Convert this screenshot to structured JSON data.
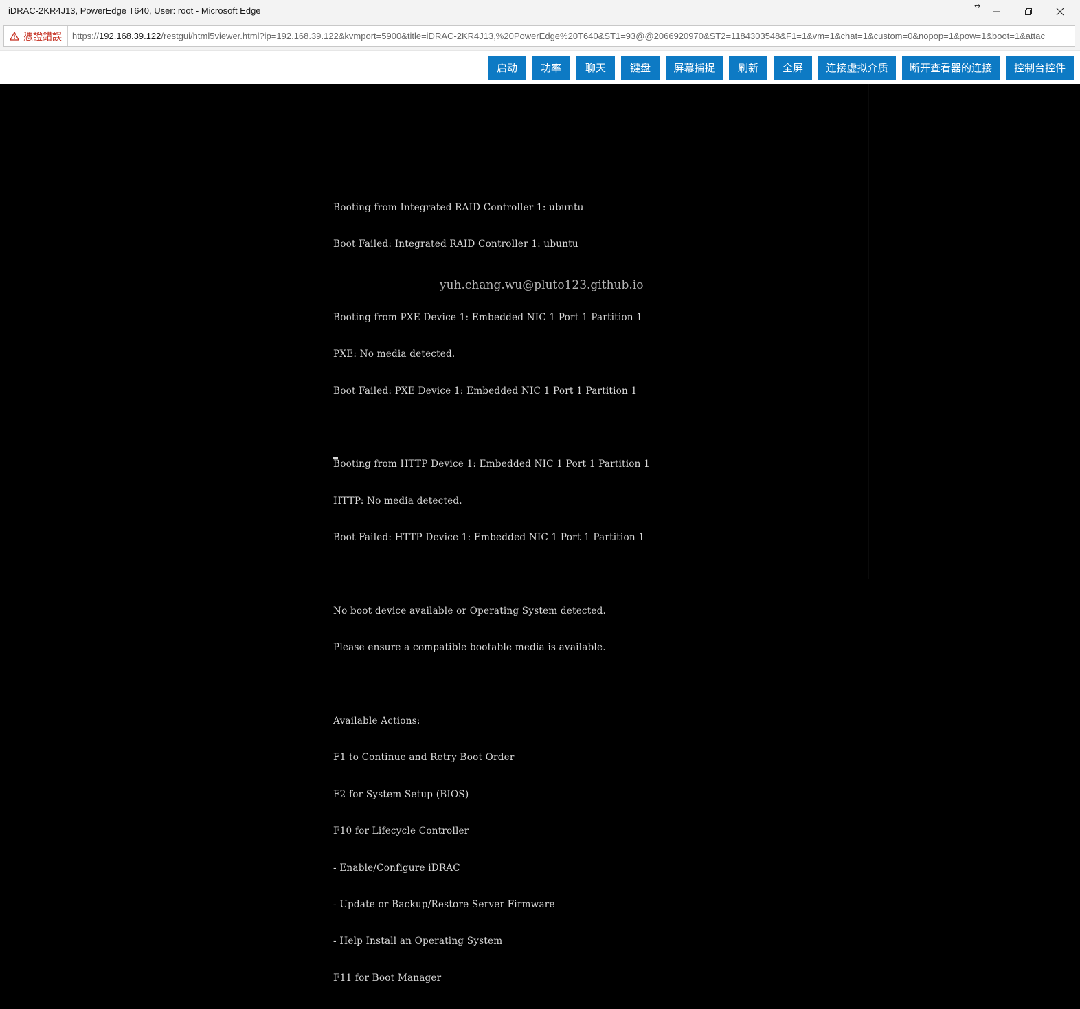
{
  "window": {
    "title": "iDRAC-2KR4J13, PowerEdge T640, User: root - Microsoft Edge",
    "resize_indicator": "↔",
    "controls": [
      "minimize-icon",
      "restore-icon",
      "close-icon"
    ]
  },
  "addressbar": {
    "security_label": "憑證錯誤",
    "url_scheme": "https://",
    "url_host": "192.168.39.122",
    "url_rest": "/restgui/html5viewer.html?ip=192.168.39.122&kvmport=5900&title=iDRAC-2KR4J13,%20PowerEdge%20T640&ST1=93@@2066920970&ST2=1184303548&F1=1&vm=1&chat=1&custom=0&nopop=1&pow=1&boot=1&attac",
    "warning_color": "#c42b1c"
  },
  "toolbar": {
    "button_color": "#0d7ac4",
    "buttons": [
      {
        "label": "启动"
      },
      {
        "label": "功率"
      },
      {
        "label": "聊天"
      },
      {
        "label": "键盘"
      },
      {
        "label": "屏幕捕捉"
      },
      {
        "label": "刷新"
      },
      {
        "label": "全屏"
      },
      {
        "label": "连接虚拟介质"
      },
      {
        "label": "断开查看器的连接"
      },
      {
        "label": "控制台控件"
      }
    ]
  },
  "console": {
    "lines": [
      "Booting from Integrated RAID Controller 1: ubuntu",
      "Boot Failed: Integrated RAID Controller 1: ubuntu",
      "",
      "Booting from PXE Device 1: Embedded NIC 1 Port 1 Partition 1",
      "PXE: No media detected.",
      "Boot Failed: PXE Device 1: Embedded NIC 1 Port 1 Partition 1",
      "",
      "Booting from HTTP Device 1: Embedded NIC 1 Port 1 Partition 1",
      "HTTP: No media detected.",
      "Boot Failed: HTTP Device 1: Embedded NIC 1 Port 1 Partition 1",
      "",
      "No boot device available or Operating System detected.",
      "Please ensure a compatible bootable media is available.",
      "",
      "Available Actions:",
      "F1 to Continue and Retry Boot Order",
      "F2 for System Setup (BIOS)",
      "F10 for Lifecycle Controller",
      "- Enable/Configure iDRAC",
      "- Update or Backup/Restore Server Firmware",
      "- Help Install an Operating System",
      "F11 for Boot Manager"
    ],
    "watermark": "yuh.chang.wu@pluto123.github.io"
  }
}
